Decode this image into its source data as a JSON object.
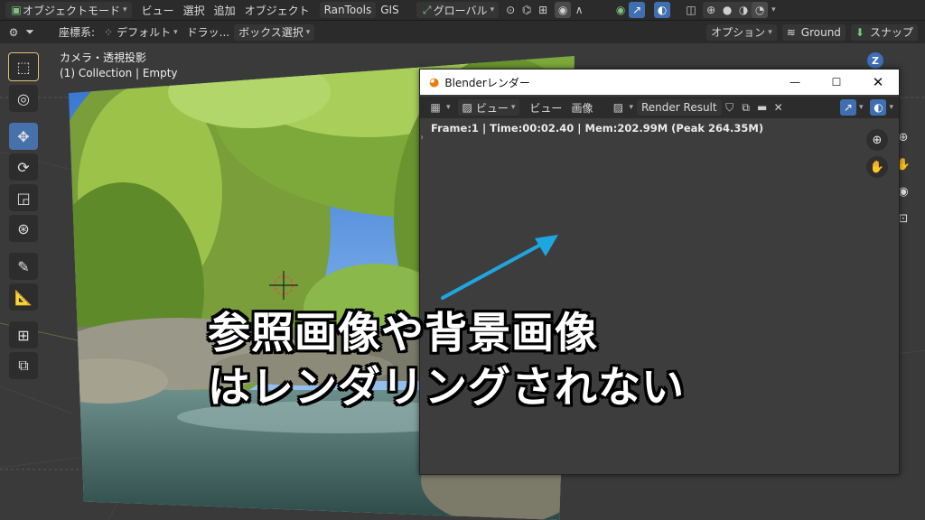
{
  "top_bar": {
    "mode_label": "オブジェクトモード",
    "menu": [
      "ビュー",
      "選択",
      "追加",
      "オブジェクト"
    ],
    "rantools_label": "RanTools",
    "gis_label": "GIS",
    "transform_orientation": "グローバル"
  },
  "second_bar": {
    "coord_label": "座標系:",
    "coord_value": "デフォルト",
    "drag_label": "ドラッ...",
    "select_mode": "ボックス選択",
    "options_label": "オプション",
    "ground_label": "Ground",
    "snap_label": "スナップ"
  },
  "viewport": {
    "view_name": "カメラ・透視投影",
    "collection_info": "(1) Collection | Empty",
    "axis_z_label": "Z"
  },
  "render_window": {
    "title": "Blenderレンダー",
    "view_label": "ビュー",
    "view_menu": "ビュー",
    "image_menu": "画像",
    "image_name": "Render Result",
    "status": "Frame:1 | Time:00:02.40 | Mem:202.99M (Peak 264.35M)"
  },
  "caption": {
    "line1": "参照画像や背景画像",
    "line2": "はレンダリングされない"
  },
  "colors": {
    "accent_blue": "#4671aa",
    "arrow": "#1fa6e0"
  }
}
